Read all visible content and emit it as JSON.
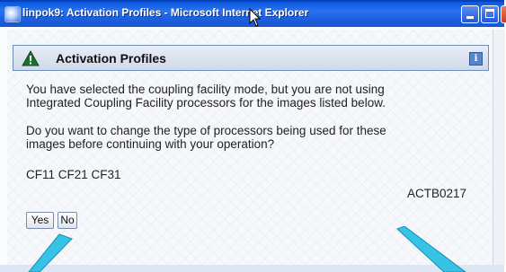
{
  "window": {
    "title": "linpok9: Activation Profiles - Microsoft Internet Explorer",
    "controls": {
      "minimize": "",
      "maximize": "",
      "close": ""
    }
  },
  "panel": {
    "title": "Activation Profiles",
    "info_label": "i",
    "icons": {
      "warning": "warning-triangle",
      "info": "info"
    }
  },
  "message": {
    "line1": "You have selected the coupling facility mode, but you are not using",
    "line2": "Integrated Coupling Facility processors for the images listed below.",
    "line3": "Do you want to change the type of processors being used for these",
    "line4": "images before continuing with your operation?",
    "images": "CF11 CF21 CF31",
    "code": "ACTB0217"
  },
  "buttons": {
    "yes": "Yes",
    "no": "No"
  },
  "colors": {
    "titlebar": "#1b5fe0",
    "panel_border": "#6f8fb8",
    "warning_icon": "#1f6e2f",
    "callout_arrow": "#37c3e6"
  }
}
